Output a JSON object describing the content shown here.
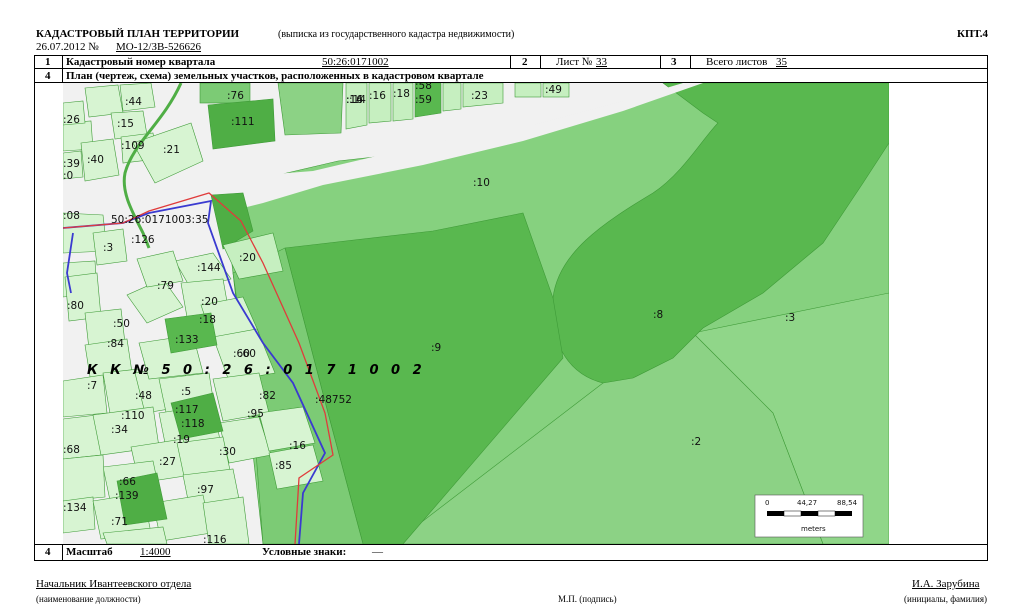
{
  "header": {
    "title": "КАДАСТРОВЫЙ ПЛАН ТЕРРИТОРИИ",
    "subtitle": "(выписка из государственного кадастра недвижимости)",
    "form_code": "КПТ.4",
    "date_number": "26.07.2012 №",
    "doc_number": "МО-12/ЗВ-526626"
  },
  "row1": {
    "num": "1",
    "label": "Кадастровый номер квартала",
    "value": "50:26:0171002",
    "sheet_num": "2",
    "sheet_label": "Лист №",
    "sheet_value": "33",
    "total_num": "3",
    "total_label": "Всего листов",
    "total_value": "35"
  },
  "row2": {
    "num": "4",
    "label": "План (чертеж, схема) земельных участков, расположенных в кадастровом квартале"
  },
  "footer_row": {
    "num": "4",
    "scale_label": "Масштаб",
    "scale_value": "1:4000",
    "legend_label": "Условные знаки:",
    "legend_value": "—"
  },
  "signatures": {
    "position": "Начальник Ивантеевского отдела",
    "position_caption": "(наименование должности)",
    "stamp_caption": "М.П. (подпись)",
    "name": "И.А. Зарубина",
    "name_caption": "(инициалы, фамилия)"
  },
  "map": {
    "quarter_label": "К К  № 5 0 : 2 6 : 0 1 7 1 0 0 2",
    "parcel_label": "50:26:0171003:35",
    "parcels": [
      {
        "id": ":10"
      },
      {
        "id": ":9"
      },
      {
        "id": ":8"
      },
      {
        "id": ":3"
      },
      {
        "id": ":2"
      },
      {
        "id": ":48752"
      },
      {
        "id": ":111"
      },
      {
        "id": ":76"
      },
      {
        "id": ":14"
      },
      {
        "id": ":44"
      },
      {
        "id": ":15"
      },
      {
        "id": ":16"
      },
      {
        "id": ":40"
      },
      {
        "id": ":39"
      },
      {
        "id": ":109"
      },
      {
        "id": ":21"
      },
      {
        "id": ":26"
      },
      {
        "id": ":58"
      },
      {
        "id": ":59"
      },
      {
        "id": ":18"
      },
      {
        "id": ":23"
      },
      {
        "id": ":49"
      },
      {
        "id": ":08"
      },
      {
        "id": ":3"
      },
      {
        "id": ":126"
      },
      {
        "id": ":20"
      },
      {
        "id": ":144"
      },
      {
        "id": ":79"
      },
      {
        "id": ":80"
      },
      {
        "id": ":20"
      },
      {
        "id": ":18"
      },
      {
        "id": ":50"
      },
      {
        "id": ":133"
      },
      {
        "id": ":84"
      },
      {
        "id": ":60"
      },
      {
        "id": ":7"
      },
      {
        "id": ":48"
      },
      {
        "id": ":5"
      },
      {
        "id": ":82"
      },
      {
        "id": ":117"
      },
      {
        "id": ":95"
      },
      {
        "id": ":110"
      },
      {
        "id": ":118"
      },
      {
        "id": ":34"
      },
      {
        "id": ":19"
      },
      {
        "id": ":30"
      },
      {
        "id": ":16"
      },
      {
        "id": ":85"
      },
      {
        "id": ":27"
      },
      {
        "id": ":68"
      },
      {
        "id": ":66"
      },
      {
        "id": ":97"
      },
      {
        "id": ":139"
      },
      {
        "id": ":134"
      },
      {
        "id": ":71"
      },
      {
        "id": ":116"
      },
      {
        "id": ":0"
      },
      {
        "id": ":60"
      },
      {
        "id": ":14"
      },
      {
        "id": ":16"
      }
    ],
    "scale_bar": {
      "ticks": [
        "0",
        "44,27",
        "88,54"
      ],
      "unit": "meters"
    }
  },
  "colors": {
    "dark_green": "#55b24a",
    "mid_green": "#7cc976",
    "light_green": "#c6efc0",
    "pale_green": "#d7f4d2",
    "road": "#f1f1f1",
    "quarter_border": "#e03b3b",
    "district_border": "#3a3ad0"
  }
}
